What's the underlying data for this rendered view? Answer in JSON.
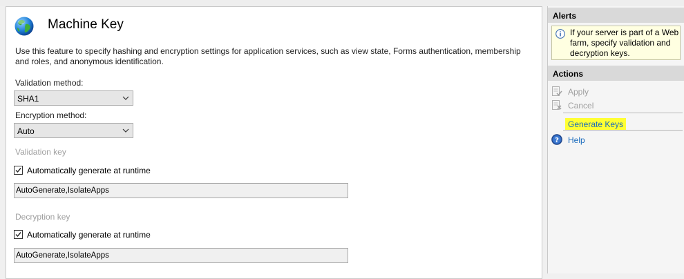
{
  "feature": {
    "icon": "globe-icon",
    "title": "Machine Key",
    "description": "Use this feature to specify hashing and encryption settings for application services, such as view state, Forms authentication, membership and roles, and anonymous identification."
  },
  "validation_method": {
    "label": "Validation method:",
    "value": "SHA1"
  },
  "encryption_method": {
    "label": "Encryption method:",
    "value": "Auto"
  },
  "validation_key": {
    "label": "Validation key",
    "auto_label": "Automatically generate at runtime",
    "auto_checked": true,
    "value": "AutoGenerate,IsolateApps"
  },
  "decryption_key": {
    "label": "Decryption key",
    "auto_label": "Automatically generate at runtime",
    "auto_checked": true,
    "value": "AutoGenerate,IsolateApps"
  },
  "alerts": {
    "header": "Alerts",
    "icon": "info-icon",
    "message": "If your server is part of a Web farm, specify validation and decryption keys."
  },
  "actions": {
    "header": "Actions",
    "apply": {
      "label": "Apply",
      "icon": "apply-icon",
      "enabled": false
    },
    "cancel": {
      "label": "Cancel",
      "icon": "cancel-icon",
      "enabled": false
    },
    "generate_keys": {
      "label": "Generate Keys",
      "highlight_color": "#ffff33"
    },
    "help": {
      "label": "Help",
      "icon": "help-icon"
    }
  },
  "colors": {
    "link": "#1a6bbd",
    "disabled_text": "#a0a0a0",
    "section_header_bg": "#d9d9d9",
    "alert_bg": "#ffffe1"
  }
}
